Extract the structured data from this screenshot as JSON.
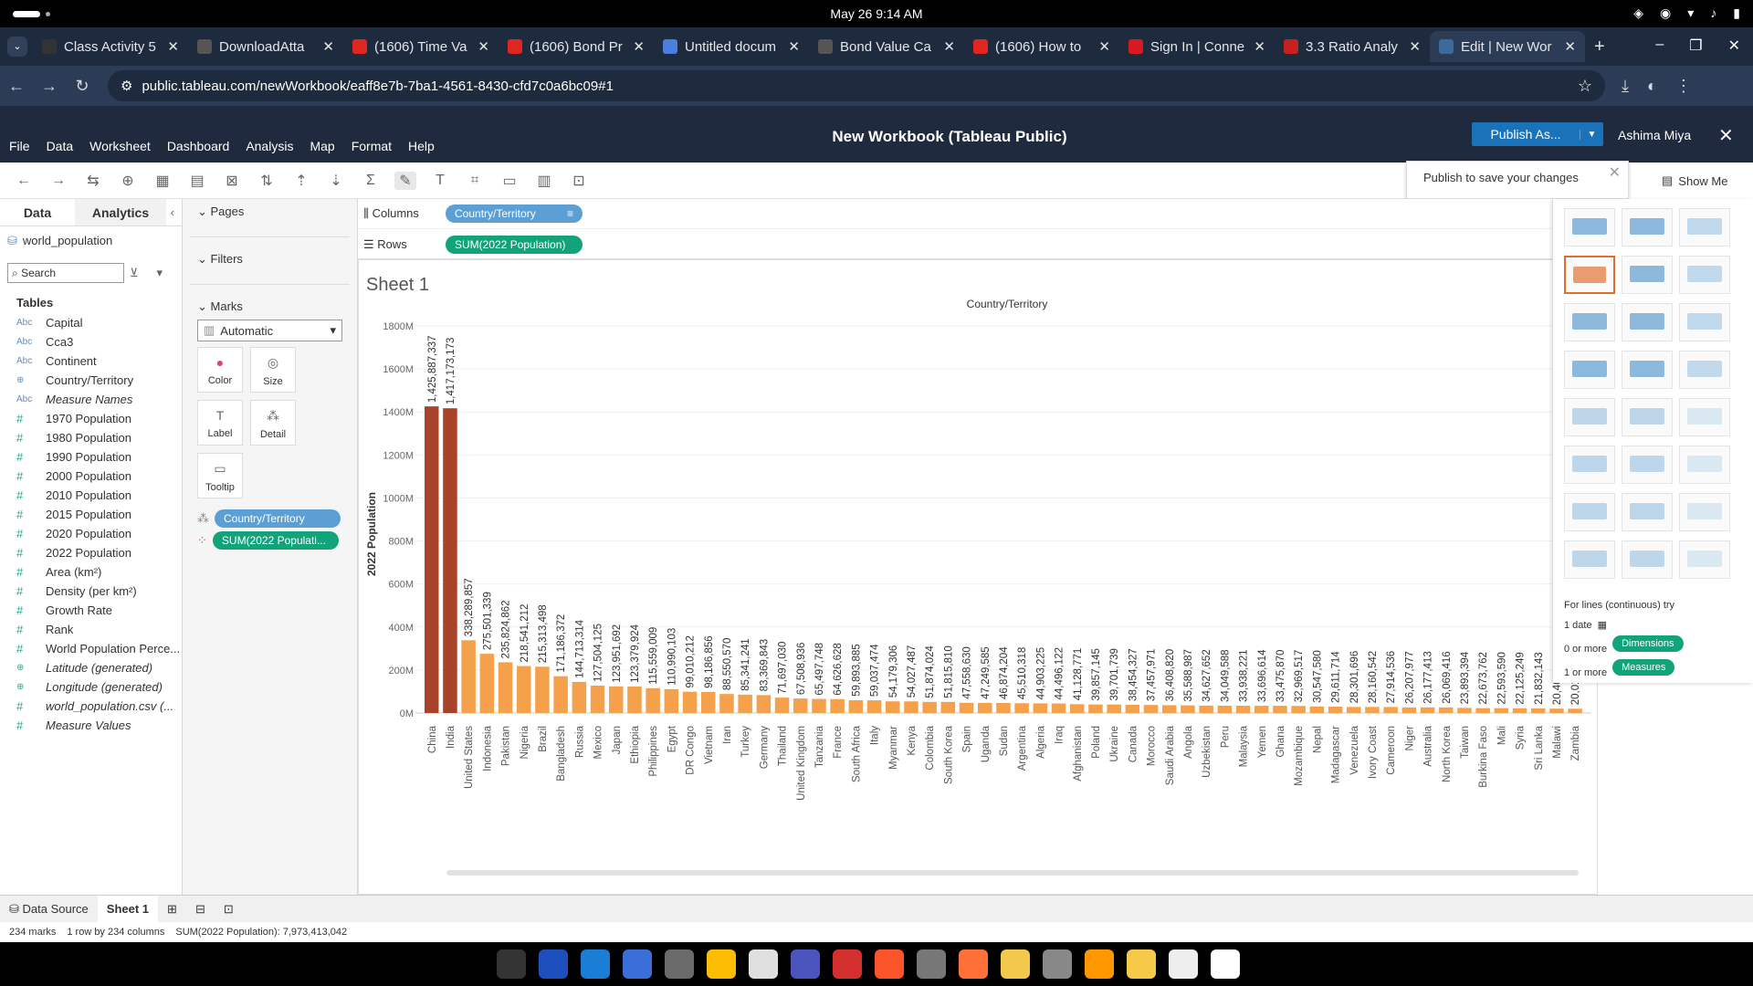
{
  "system": {
    "clock": "May 26   9:14 AM"
  },
  "tabs": [
    {
      "title": "Class Activity 5",
      "icon": "dxl-icon",
      "color": "#333333"
    },
    {
      "title": "DownloadAtta",
      "icon": "globe-icon",
      "color": "#555555"
    },
    {
      "title": "(1606) Time Va",
      "icon": "youtube-icon",
      "color": "#e0261e"
    },
    {
      "title": "(1606) Bond Pr",
      "icon": "youtube-icon",
      "color": "#e0261e"
    },
    {
      "title": "Untitled docum",
      "icon": "google-docs-icon",
      "color": "#4a7fe0"
    },
    {
      "title": "Bond Value Ca",
      "icon": "globe-icon",
      "color": "#555555"
    },
    {
      "title": "(1606) How to",
      "icon": "youtube-icon",
      "color": "#e0261e"
    },
    {
      "title": "Sign In | Conne",
      "icon": "mcgraw-icon",
      "color": "#d71920"
    },
    {
      "title": "3.3 Ratio Analy",
      "icon": "pdf-icon",
      "color": "#c81f1f"
    },
    {
      "title": "Edit | New Wor",
      "icon": "tableau-icon",
      "color": "#3d6a9a"
    }
  ],
  "address": {
    "url": "public.tableau.com/newWorkbook/eaff8e7b-7ba1-4561-8430-cfd7c0a6bc09#1"
  },
  "app": {
    "menu": [
      "File",
      "Data",
      "Worksheet",
      "Dashboard",
      "Analysis",
      "Map",
      "Format",
      "Help"
    ],
    "title": "New Workbook (Tableau Public)",
    "publish": "Publish As...",
    "user": "Ashima Miya",
    "publish_tip": "Publish to save your changes",
    "show_me": "Show Me"
  },
  "data_pane": {
    "tab_data": "Data",
    "tab_analytics": "Analytics",
    "source": "world_population",
    "search_placeholder": "Search",
    "tables_label": "Tables",
    "fields": [
      {
        "name": "Capital",
        "type": "Abc",
        "italic": false
      },
      {
        "name": "Cca3",
        "type": "Abc",
        "italic": false
      },
      {
        "name": "Continent",
        "type": "Abc",
        "italic": false
      },
      {
        "name": "Country/Territory",
        "type": "geo",
        "italic": false
      },
      {
        "name": "Measure Names",
        "type": "Abc",
        "italic": true
      },
      {
        "name": "1970 Population",
        "type": "#",
        "italic": false
      },
      {
        "name": "1980 Population",
        "type": "#",
        "italic": false
      },
      {
        "name": "1990 Population",
        "type": "#",
        "italic": false
      },
      {
        "name": "2000 Population",
        "type": "#",
        "italic": false
      },
      {
        "name": "2010 Population",
        "type": "#",
        "italic": false
      },
      {
        "name": "2015 Population",
        "type": "#",
        "italic": false
      },
      {
        "name": "2020 Population",
        "type": "#",
        "italic": false
      },
      {
        "name": "2022 Population",
        "type": "#",
        "italic": false
      },
      {
        "name": "Area (km²)",
        "type": "#",
        "italic": false
      },
      {
        "name": "Density (per km²)",
        "type": "#",
        "italic": false
      },
      {
        "name": "Growth Rate",
        "type": "#",
        "italic": false
      },
      {
        "name": "Rank",
        "type": "#",
        "italic": false
      },
      {
        "name": "World Population Perce...",
        "type": "#",
        "italic": false
      },
      {
        "name": "Latitude (generated)",
        "type": "geo",
        "italic": true
      },
      {
        "name": "Longitude (generated)",
        "type": "geo",
        "italic": true
      },
      {
        "name": "world_population.csv (...",
        "type": "#",
        "italic": true
      },
      {
        "name": "Measure Values",
        "type": "#",
        "italic": true
      }
    ]
  },
  "cards": {
    "pages": "Pages",
    "filters": "Filters",
    "marks": "Marks",
    "mark_type": "Automatic",
    "buttons": [
      "Color",
      "Size",
      "Label",
      "Detail",
      "Tooltip"
    ],
    "mark_pill_dim": "Country/Territory",
    "mark_pill_mea": "SUM(2022 Populati..."
  },
  "shelves": {
    "columns_label": "Columns",
    "columns_pill": "Country/Territory",
    "rows_label": "Rows",
    "rows_pill": "SUM(2022 Population)"
  },
  "sheet": {
    "title": "Sheet 1"
  },
  "chart_data": {
    "type": "bar",
    "title": "Country/Territory",
    "ylabel": "2022 Population",
    "ylim": [
      0,
      1800000000
    ],
    "yticks": [
      "0M",
      "200M",
      "400M",
      "600M",
      "800M",
      "1000M",
      "1200M",
      "1400M",
      "1600M",
      "1800M"
    ],
    "grid": true,
    "colors": {
      "high": "#a8432a",
      "low": "#f5a04a"
    },
    "categories": [
      "China",
      "India",
      "United States",
      "Indonesia",
      "Pakistan",
      "Nigeria",
      "Brazil",
      "Bangladesh",
      "Russia",
      "Mexico",
      "Japan",
      "Ethiopia",
      "Philippines",
      "Egypt",
      "DR Congo",
      "Vietnam",
      "Iran",
      "Turkey",
      "Germany",
      "Thailand",
      "United Kingdom",
      "Tanzania",
      "France",
      "South Africa",
      "Italy",
      "Myanmar",
      "Kenya",
      "Colombia",
      "South Korea",
      "Spain",
      "Uganda",
      "Sudan",
      "Argentina",
      "Algeria",
      "Iraq",
      "Afghanistan",
      "Poland",
      "Ukraine",
      "Canada",
      "Morocco",
      "Saudi Arabia",
      "Angola",
      "Uzbekistan",
      "Peru",
      "Malaysia",
      "Yemen",
      "Ghana",
      "Mozambique",
      "Nepal",
      "Madagascar",
      "Venezuela",
      "Ivory Coast",
      "Cameroon",
      "Niger",
      "Australia",
      "North Korea",
      "Taiwan",
      "Burkina Faso",
      "Mali",
      "Syria",
      "Sri Lanka",
      "Malawi",
      "Zambia"
    ],
    "values": [
      1425887337,
      1417173173,
      338289857,
      275501339,
      235824862,
      218541212,
      215313498,
      171186372,
      144713314,
      127504125,
      123951692,
      123379924,
      115559009,
      110990103,
      99010212,
      98186856,
      88550570,
      85341241,
      83369843,
      71697030,
      67508936,
      65497748,
      64626628,
      59893885,
      59037474,
      54179306,
      54027487,
      51874024,
      51815810,
      47558630,
      47249585,
      46874204,
      45510318,
      44903225,
      44496122,
      41128771,
      39857145,
      39701739,
      38454327,
      37457971,
      36408820,
      35588987,
      34627652,
      34049588,
      33938221,
      33696614,
      33475870,
      32969517,
      30547580,
      29611714,
      28301696,
      28160542,
      27914536,
      26207977,
      26177413,
      26069416,
      23893394,
      22673762,
      22593590,
      22125249,
      21832143,
      20405317,
      20017675
    ],
    "data_labels": [
      "1,425,887,337",
      "1,417,173,173",
      "338,289,857",
      "275,501,339",
      "235,824,862",
      "218,541,212",
      "215,313,498",
      "171,186,372",
      "144,713,314",
      "127,504,125",
      "123,951,692",
      "123,379,924",
      "115,559,009",
      "110,990,103",
      "99,010,212",
      "98,186,856",
      "88,550,570",
      "85,341,241",
      "83,369,843",
      "71,697,030",
      "67,508,936",
      "65,497,748",
      "64,626,628",
      "59,893,885",
      "59,037,474",
      "54,179,306",
      "54,027,487",
      "51,874,024",
      "51,815,810",
      "47,558,630",
      "47,249,585",
      "46,874,204",
      "45,510,318",
      "44,903,225",
      "44,496,122",
      "41,128,771",
      "39,857,145",
      "39,701,739",
      "38,454,327",
      "37,457,971",
      "36,408,820",
      "35,588,987",
      "34,627,652",
      "34,049,588",
      "33,938,221",
      "33,696,614",
      "33,475,870",
      "32,969,517",
      "30,547,580",
      "29,611,714",
      "28,301,696",
      "28,160,542",
      "27,914,536",
      "26,207,977",
      "26,177,413",
      "26,069,416",
      "23,893,394",
      "22,673,762",
      "22,593,590",
      "22,125,249",
      "21,832,143",
      "20,40",
      "20,01"
    ]
  },
  "showme": {
    "hint_title": "For lines (continuous) try",
    "hint_date": "1 date",
    "hint_dim": "0 or more",
    "hint_dim_pill": "Dimensions",
    "hint_mea": "1 or more",
    "hint_mea_pill": "Measures"
  },
  "bottom": {
    "data_source": "Data Source",
    "sheet_tab": "Sheet 1"
  },
  "status": {
    "marks": "234 marks",
    "rows_cols": "1 row by 234 columns",
    "sum": "SUM(2022 Population): 7,973,413,042"
  }
}
